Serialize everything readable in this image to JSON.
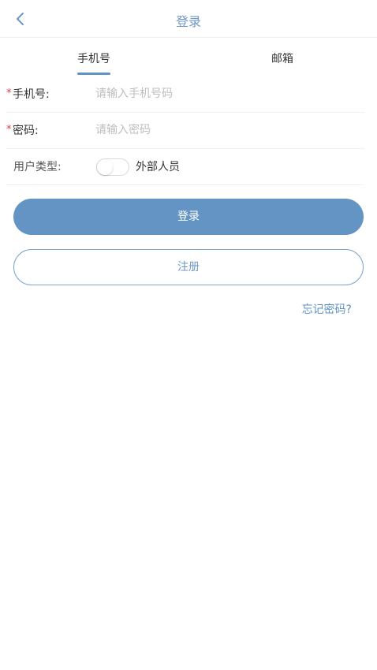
{
  "header": {
    "title": "登录"
  },
  "tabs": [
    {
      "label": "手机号",
      "active": true
    },
    {
      "label": "邮箱",
      "active": false
    }
  ],
  "form": {
    "phone": {
      "required_mark": "*",
      "label": "手机号:",
      "placeholder": "请输入手机号码",
      "value": ""
    },
    "password": {
      "required_mark": "*",
      "label": "密码:",
      "placeholder": "请输入密码",
      "value": ""
    },
    "user_type": {
      "label": "用户类型:",
      "toggle_on": false,
      "option_label": "外部人员"
    }
  },
  "buttons": {
    "login": "登录",
    "register": "注册"
  },
  "links": {
    "forgot_password": "忘记密码?"
  },
  "colors": {
    "accent": "#6394c4",
    "required": "#e23b3b",
    "placeholder": "#bdbdbd"
  }
}
